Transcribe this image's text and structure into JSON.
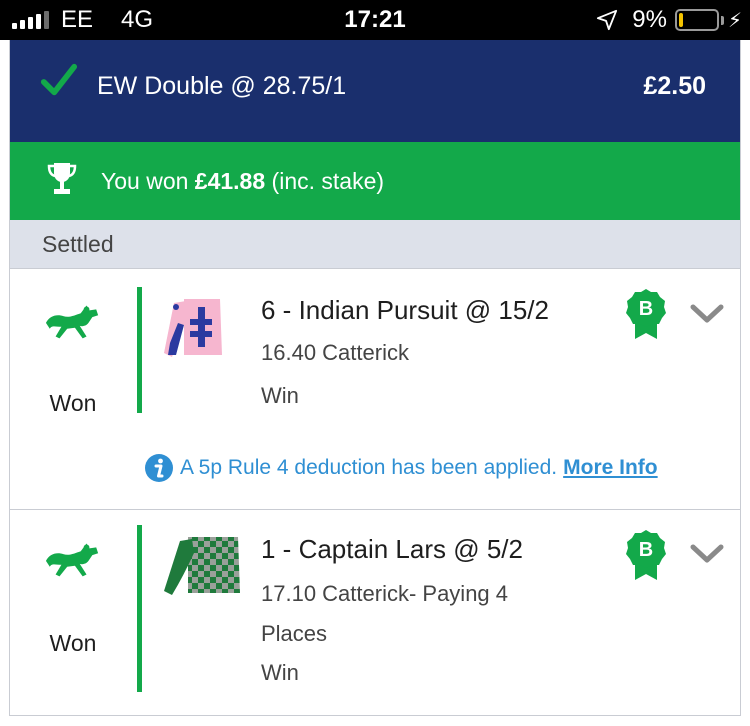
{
  "status_bar": {
    "carrier": "EE",
    "network": "4G",
    "time": "17:21",
    "battery": "9%",
    "battery_level": 0.09
  },
  "bet": {
    "title": "EW Double @ 28.75/1",
    "stake": "£2.50",
    "win_prefix": "You won ",
    "win_amount": "£41.88",
    "win_suffix": " (inc. stake)",
    "status": "Settled"
  },
  "legs": [
    {
      "result": "Won",
      "selection": "6 - Indian Pursuit @ 15/2",
      "race": "16.40 Catterick",
      "market": "Win",
      "badge": "B",
      "info_text": "A 5p Rule 4 deduction has been applied.",
      "info_link": "More Info"
    },
    {
      "result": "Won",
      "selection": "1 - Captain Lars @ 5/2",
      "race": "17.10 Catterick- Paying 4 Places",
      "market": "Win",
      "badge": "B"
    }
  ],
  "colors": {
    "header_navy": "#1a2f6d",
    "win_green": "#13a94a",
    "settled_bg": "#dde1ea",
    "link_blue": "#2f8fd3"
  },
  "icons": [
    "check-icon",
    "trophy-icon",
    "horse-icon",
    "silk-icon",
    "bog-badge-icon",
    "chevron-down-icon",
    "info-icon",
    "location-arrow-icon",
    "battery-icon",
    "signal-icon"
  ]
}
